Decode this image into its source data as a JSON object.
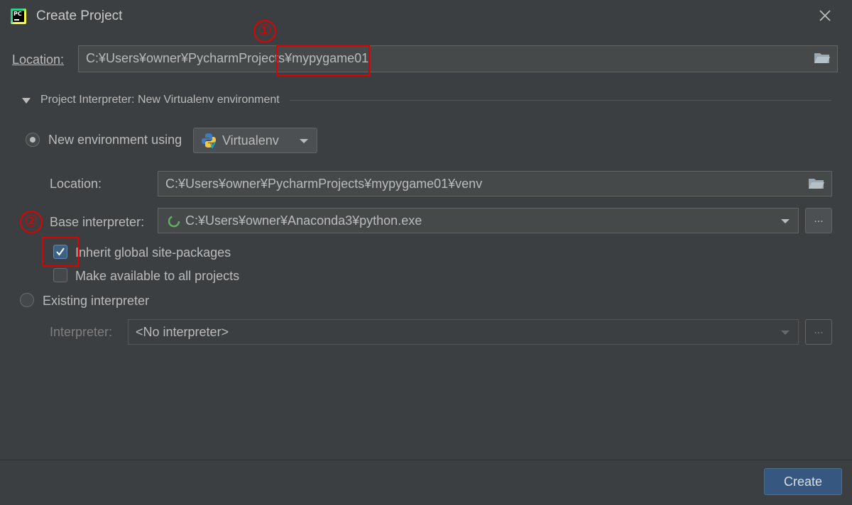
{
  "window": {
    "title": "Create Project"
  },
  "location": {
    "label": "Location:",
    "value": "C:¥Users¥owner¥PycharmProjects¥mypygame01"
  },
  "interpreter_section": {
    "title": "Project Interpreter: New Virtualenv environment",
    "new_env": {
      "label": "New environment using",
      "selected": true,
      "tool": "Virtualenv"
    },
    "venv_location": {
      "label": "Location:",
      "value": "C:¥Users¥owner¥PycharmProjects¥mypygame01¥venv"
    },
    "base_interpreter": {
      "label": "Base interpreter:",
      "value": "C:¥Users¥owner¥Anaconda3¥python.exe",
      "browse": "..."
    },
    "inherit_packages": {
      "label": "Inherit global site-packages",
      "checked": true
    },
    "make_available": {
      "label": "Make available to all projects",
      "checked": false
    },
    "existing": {
      "label": "Existing interpreter",
      "selected": false,
      "interpreter_label": "Interpreter:",
      "interpreter_value": "<No interpreter>",
      "browse": "..."
    }
  },
  "annotations": {
    "one": "①",
    "two": "②"
  },
  "actions": {
    "create": "Create"
  },
  "colors": {
    "background": "#3c3f41",
    "accent": "#365880",
    "annotation": "#e00000"
  },
  "icons": [
    "pycharm-icon",
    "close-icon",
    "folder-icon",
    "chevron-down-icon",
    "python-icon",
    "spinner-icon",
    "checkmark-icon",
    "dropdown-arrow-icon"
  ]
}
